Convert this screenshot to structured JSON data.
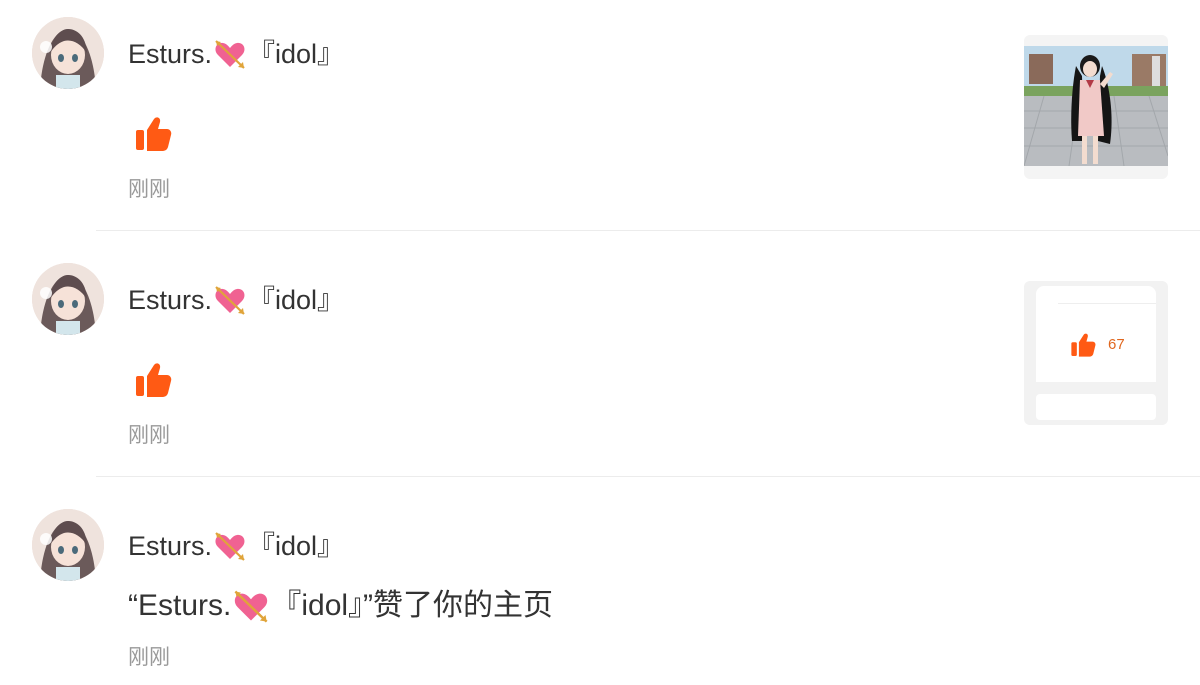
{
  "notifications": [
    {
      "username_prefix": "Esturs.",
      "username_suffix": "『idol』",
      "reaction_icon": "thumbs-up-icon",
      "time": "刚刚",
      "thumbnail": "image-post-anime-girl"
    },
    {
      "username_prefix": "Esturs.",
      "username_suffix": "『idol』",
      "reaction_icon": "thumbs-up-icon",
      "time": "刚刚",
      "thumbnail_card": {
        "like_count": "67"
      }
    },
    {
      "username_prefix": "Esturs.",
      "username_suffix": "『idol』",
      "message_prefix": "“Esturs.",
      "message_suffix": "『idol』”赞了你的主页",
      "time": "刚刚"
    }
  ],
  "colors": {
    "accent_orange": "#ff5a14",
    "like_count_color": "#e0671f",
    "heart_pink": "#f06292",
    "time_gray": "#999999",
    "divider": "#ececec"
  },
  "icons": [
    "avatar-anime-girl",
    "heart-with-arrow-icon",
    "thumbs-up-icon"
  ]
}
